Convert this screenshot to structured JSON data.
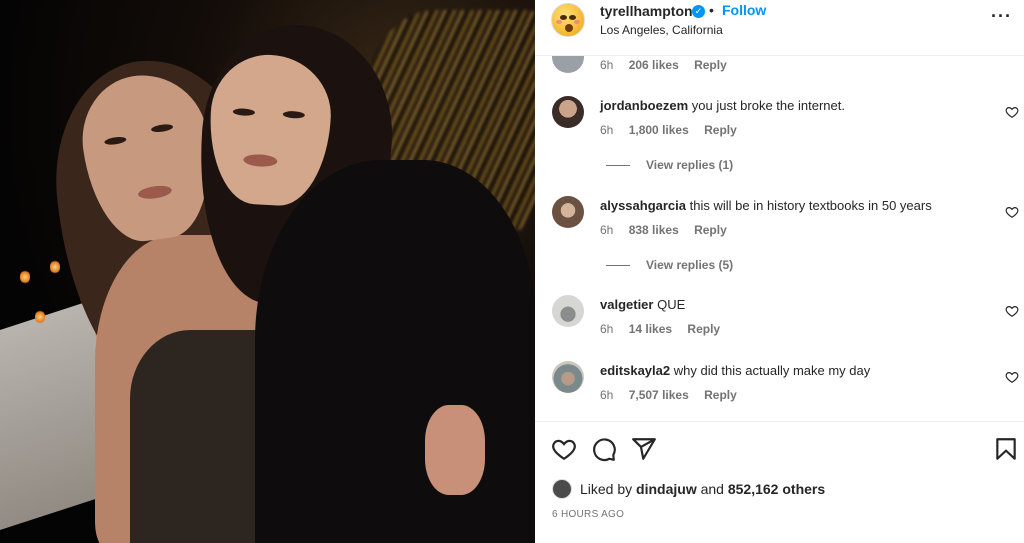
{
  "post": {
    "username": "tyrellhampton",
    "follow_label": "Follow",
    "separator": "•",
    "location": "Los Angeles, California",
    "more_icon": "more-options-icon"
  },
  "comments": [
    {
      "username": "",
      "text": "",
      "time": "6h",
      "likes": "206 likes",
      "reply": "Reply"
    },
    {
      "username": "jordanboezem",
      "text": "you just broke the internet.",
      "time": "6h",
      "likes": "1,800 likes",
      "reply": "Reply",
      "view_replies": "View replies (1)"
    },
    {
      "username": "alyssahgarcia",
      "text": "this will be in history textbooks in 50 years",
      "time": "6h",
      "likes": "838 likes",
      "reply": "Reply",
      "view_replies": "View replies (5)"
    },
    {
      "username": "valgetier",
      "text": "QUE",
      "time": "6h",
      "likes": "14 likes",
      "reply": "Reply"
    },
    {
      "username": "editskayla2",
      "text": "why did this actually make my day",
      "time": "6h",
      "likes": "7,507 likes",
      "reply": "Reply"
    }
  ],
  "footer": {
    "liked_by_prefix": "Liked by",
    "liked_by_user": "dindajuw",
    "liked_by_and": "and",
    "liked_by_count": "852,162 others",
    "timestamp": "6 HOURS AGO"
  },
  "colors": {
    "accent": "#0095f6",
    "text": "#262626",
    "muted": "#737373"
  }
}
